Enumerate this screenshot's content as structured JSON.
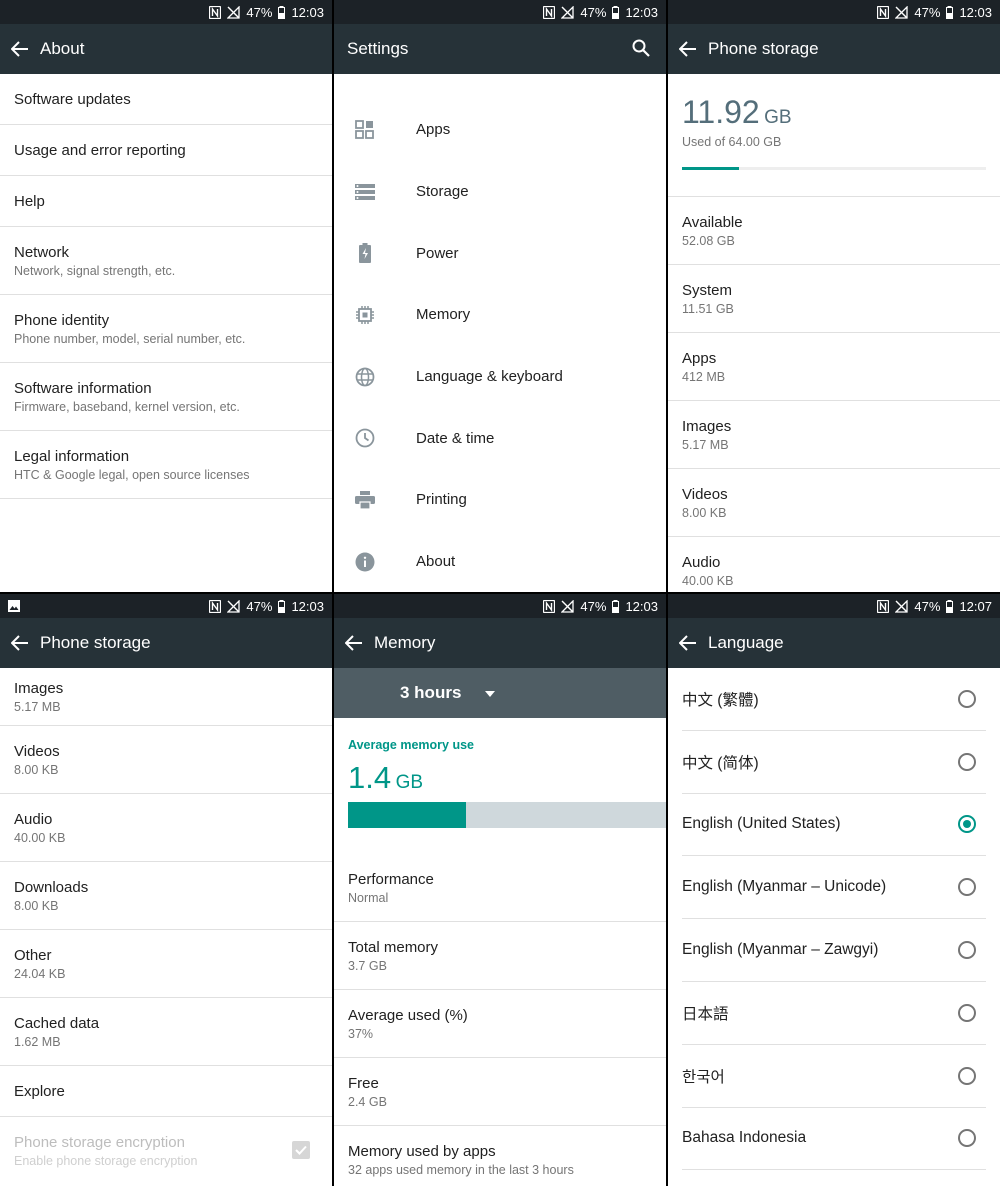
{
  "status": {
    "signal_pct": "47%",
    "time_a": "12:03",
    "time_b": "12:07"
  },
  "about": {
    "title": "About",
    "items": [
      {
        "title": "Software updates",
        "sub": ""
      },
      {
        "title": "Usage and error reporting",
        "sub": ""
      },
      {
        "title": "Help",
        "sub": ""
      },
      {
        "title": "Network",
        "sub": "Network, signal strength, etc."
      },
      {
        "title": "Phone identity",
        "sub": "Phone number, model, serial number, etc."
      },
      {
        "title": "Software information",
        "sub": "Firmware, baseband, kernel version, etc."
      },
      {
        "title": "Legal information",
        "sub": "HTC & Google legal, open source licenses"
      }
    ]
  },
  "settings": {
    "title": "Settings",
    "items": [
      {
        "label": "Apps",
        "icon": "apps-icon"
      },
      {
        "label": "Storage",
        "icon": "storage-icon"
      },
      {
        "label": "Power",
        "icon": "battery-icon"
      },
      {
        "label": "Memory",
        "icon": "chip-icon"
      },
      {
        "label": "Language & keyboard",
        "icon": "globe-icon"
      },
      {
        "label": "Date & time",
        "icon": "clock-icon"
      },
      {
        "label": "Printing",
        "icon": "printer-icon"
      },
      {
        "label": "About",
        "icon": "info-icon"
      }
    ]
  },
  "storage1": {
    "title": "Phone storage",
    "used_value": "11.92",
    "used_unit": "GB",
    "used_of": "Used of 64.00 GB",
    "used_fraction": 0.186,
    "items": [
      {
        "title": "Available",
        "sub": "52.08 GB"
      },
      {
        "title": "System",
        "sub": "11.51 GB"
      },
      {
        "title": "Apps",
        "sub": "412 MB"
      },
      {
        "title": "Images",
        "sub": "5.17 MB"
      },
      {
        "title": "Videos",
        "sub": "8.00 KB"
      },
      {
        "title": "Audio",
        "sub": "40.00 KB"
      }
    ]
  },
  "storage2": {
    "title": "Phone storage",
    "items": [
      {
        "title": "Images",
        "sub": "5.17 MB"
      },
      {
        "title": "Videos",
        "sub": "8.00 KB"
      },
      {
        "title": "Audio",
        "sub": "40.00 KB"
      },
      {
        "title": "Downloads",
        "sub": "8.00 KB"
      },
      {
        "title": "Other",
        "sub": "24.04 KB"
      },
      {
        "title": "Cached data",
        "sub": "1.62 MB"
      },
      {
        "title": "Explore",
        "sub": ""
      }
    ],
    "encryption_title": "Phone storage encryption",
    "encryption_sub": "Enable phone storage encryption"
  },
  "memory": {
    "title": "Memory",
    "period": "3 hours",
    "avg_label": "Average memory use",
    "avg_value": "1.4",
    "avg_unit": "GB",
    "avg_fraction": 0.37,
    "items": [
      {
        "title": "Performance",
        "sub": "Normal"
      },
      {
        "title": "Total memory",
        "sub": "3.7 GB"
      },
      {
        "title": "Average used (%)",
        "sub": "37%"
      },
      {
        "title": "Free",
        "sub": "2.4 GB"
      },
      {
        "title": "Memory used by apps",
        "sub": "32 apps used memory in the last 3 hours"
      }
    ]
  },
  "language": {
    "title": "Language",
    "items": [
      {
        "label": "中文 (繁體)",
        "selected": false
      },
      {
        "label": "中文 (简体)",
        "selected": false
      },
      {
        "label": "English (United States)",
        "selected": true
      },
      {
        "label": "English (Myanmar – Unicode)",
        "selected": false
      },
      {
        "label": "English (Myanmar – Zawgyi)",
        "selected": false
      },
      {
        "label": "日本語",
        "selected": false
      },
      {
        "label": "한국어",
        "selected": false
      },
      {
        "label": "Bahasa Indonesia",
        "selected": false
      }
    ]
  },
  "colors": {
    "teal": "#009688",
    "appbar": "#263238",
    "statusbar": "#1c2227",
    "memory_header": "#4f5d64"
  }
}
